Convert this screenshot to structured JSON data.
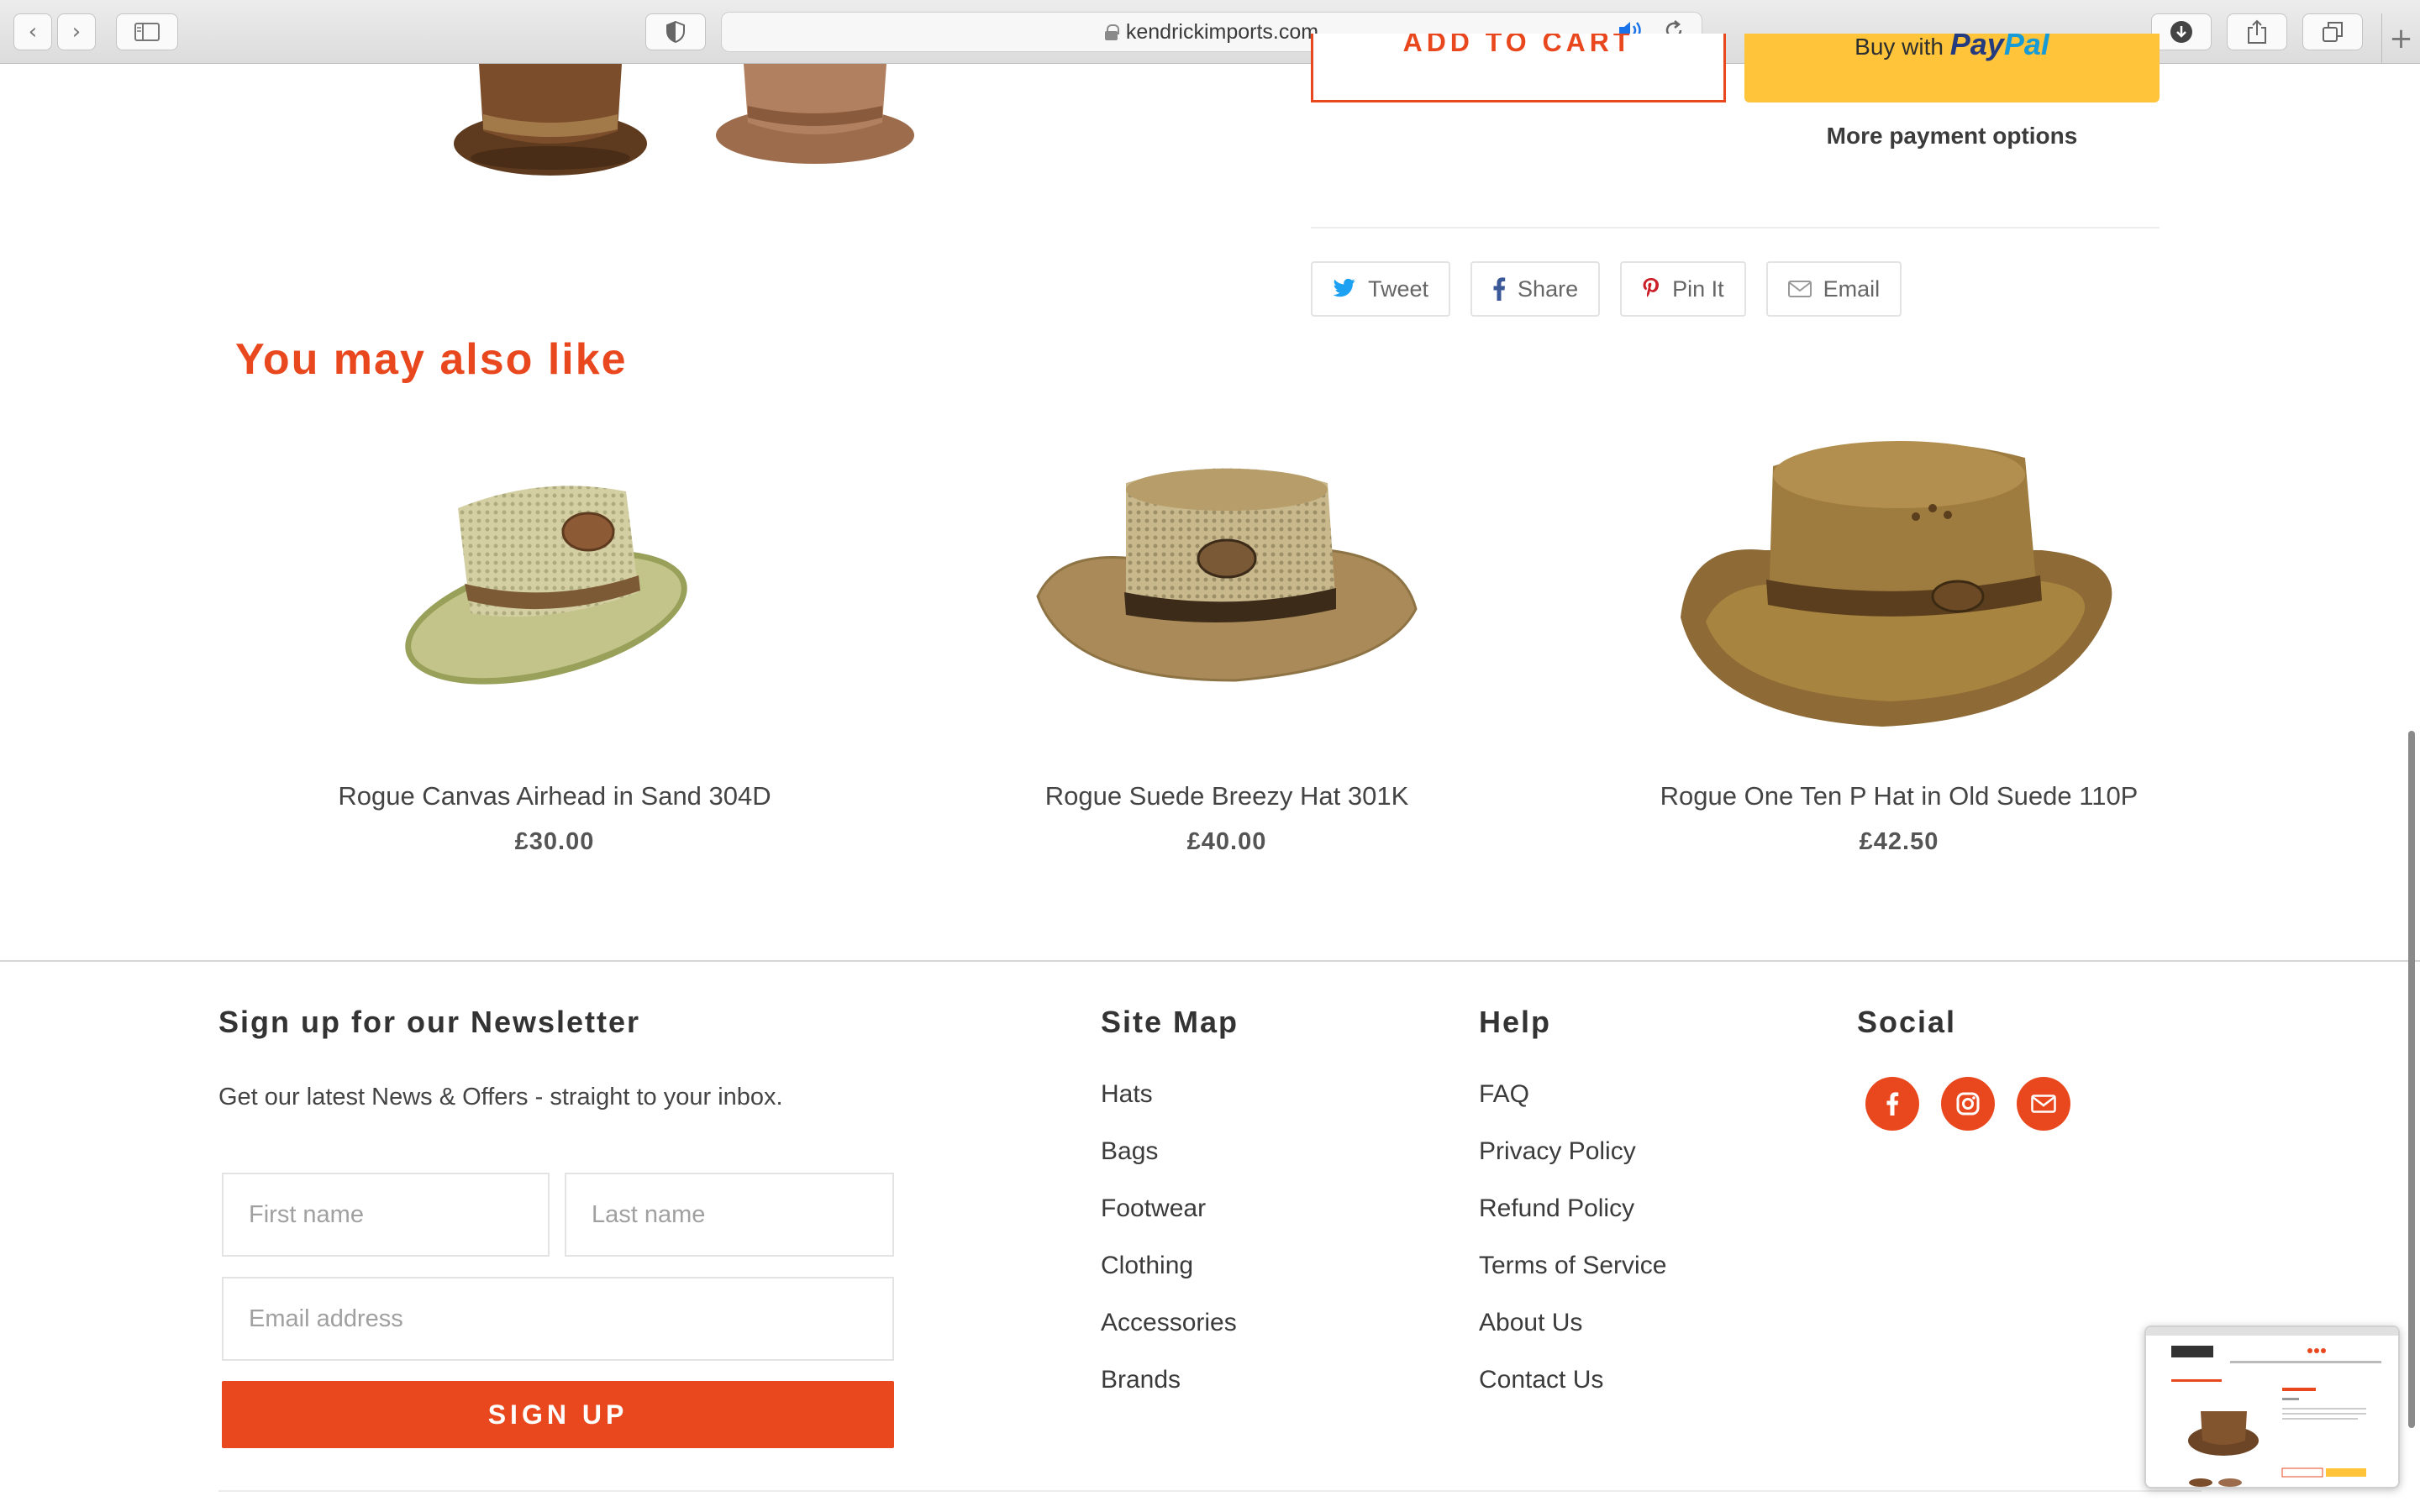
{
  "browser": {
    "url": "kendrickimports.com",
    "back_glyph": "‹",
    "forward_glyph": "›",
    "new_tab_glyph": "+"
  },
  "product_actions": {
    "add_to_cart_label": "ADD TO CART",
    "paypal_prefix": "Buy with",
    "paypal_brand_a": "Pay",
    "paypal_brand_b": "Pal",
    "more_payment_label": "More payment options"
  },
  "share": {
    "tweet": "Tweet",
    "share": "Share",
    "pin": "Pin It",
    "email": "Email"
  },
  "related": {
    "heading": "You may also like",
    "products": [
      {
        "name": "Rogue Canvas Airhead in Sand 304D",
        "price": "£30.00"
      },
      {
        "name": "Rogue Suede Breezy Hat 301K",
        "price": "£40.00"
      },
      {
        "name": "Rogue One Ten P Hat in Old Suede 110P",
        "price": "£42.50"
      }
    ]
  },
  "footer": {
    "newsletter": {
      "heading": "Sign up for our Newsletter",
      "text": "Get our latest News & Offers - straight to your inbox.",
      "first_name_placeholder": "First name",
      "last_name_placeholder": "Last name",
      "email_placeholder": "Email address",
      "button_label": "SIGN UP"
    },
    "sitemap": {
      "heading": "Site Map",
      "links": [
        "Hats",
        "Bags",
        "Footwear",
        "Clothing",
        "Accessories",
        "Brands"
      ]
    },
    "help": {
      "heading": "Help",
      "links": [
        "FAQ",
        "Privacy Policy",
        "Refund Policy",
        "Terms of Service",
        "About Us",
        "Contact Us"
      ]
    },
    "social": {
      "heading": "Social",
      "icons": [
        "facebook-icon",
        "instagram-icon",
        "email-icon"
      ]
    }
  },
  "colors": {
    "accent": "#e9481f",
    "paypal_yellow": "#ffc439"
  }
}
